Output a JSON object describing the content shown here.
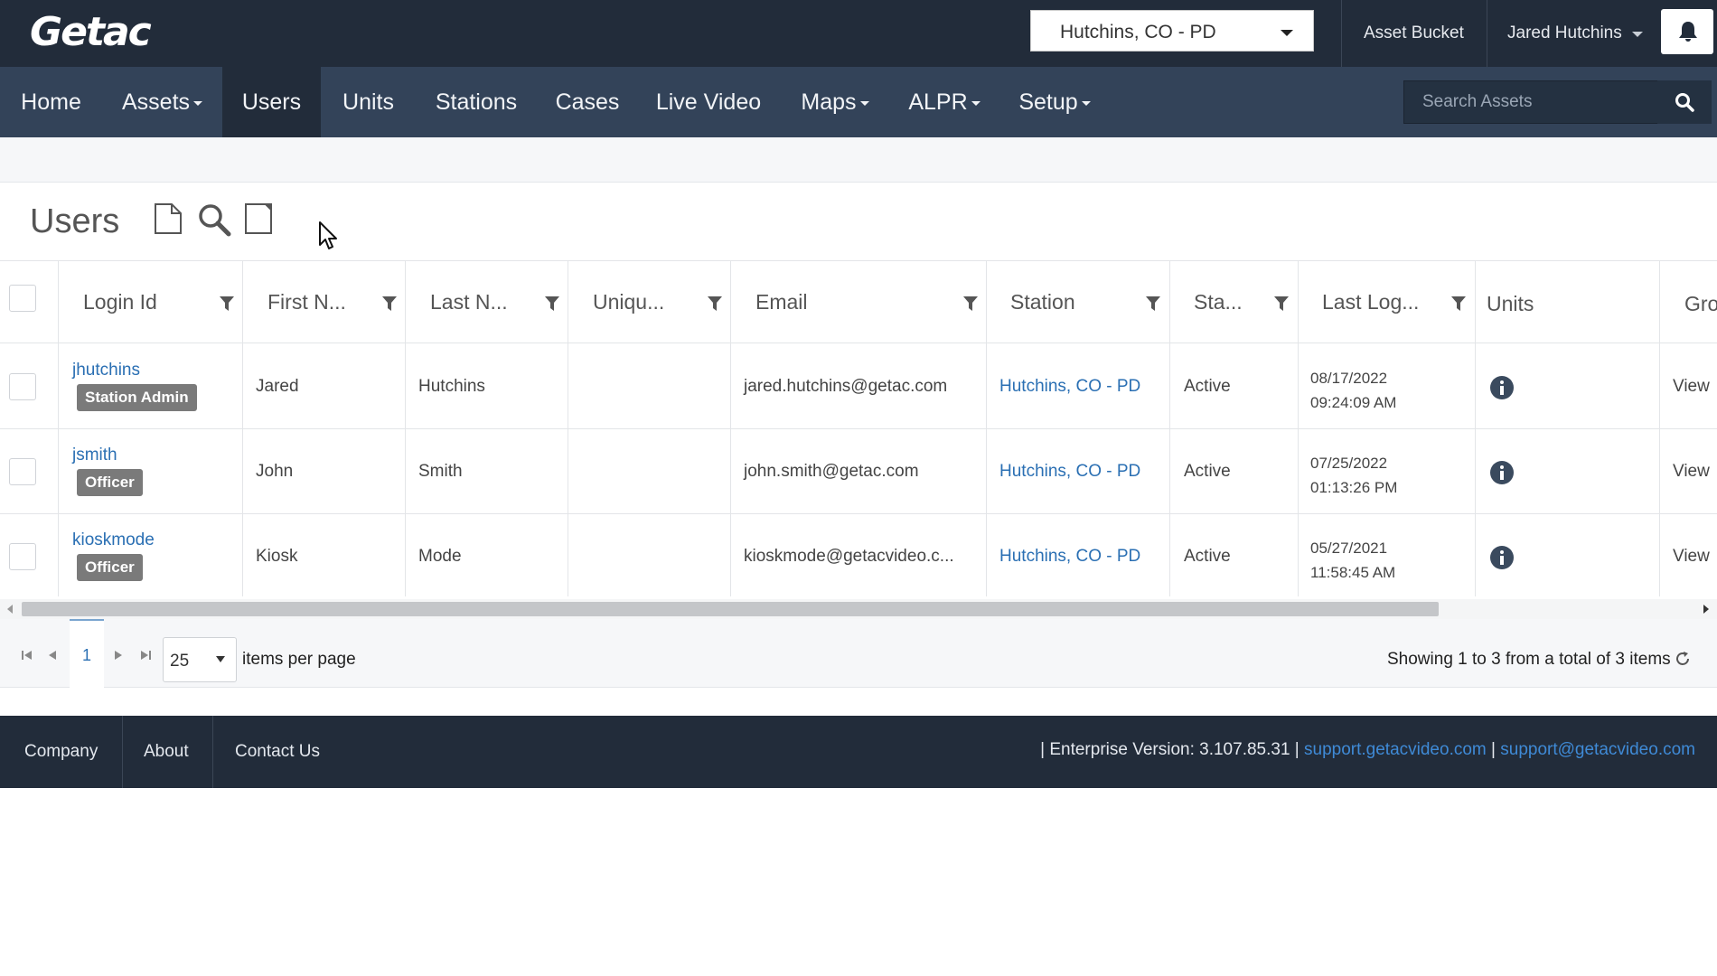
{
  "header": {
    "logo": "Getac",
    "agency_select": "Hutchins, CO - PD",
    "asset_bucket": "Asset Bucket",
    "user_name": "Jared Hutchins"
  },
  "nav": {
    "items": [
      {
        "label": "Home"
      },
      {
        "label": "Assets"
      },
      {
        "label": "Users"
      },
      {
        "label": "Units"
      },
      {
        "label": "Stations"
      },
      {
        "label": "Cases"
      },
      {
        "label": "Live Video"
      },
      {
        "label": "Maps"
      },
      {
        "label": "ALPR"
      },
      {
        "label": "Setup"
      }
    ],
    "active": "Users",
    "search_placeholder": "Search Assets"
  },
  "page": {
    "title": "Users"
  },
  "table": {
    "columns": [
      "Login Id",
      "First N...",
      "Last N...",
      "Uniqu...",
      "Email",
      "Station",
      "Sta...",
      "Last Log...",
      "Units",
      "Gro"
    ],
    "rows": [
      {
        "login": "jhutchins",
        "role": "Station Admin",
        "first": "Jared",
        "last": "Hutchins",
        "unique": "",
        "email": "jared.hutchins@getac.com",
        "station": "Hutchins, CO - PD",
        "status": "Active",
        "last_login_date": "08/17/2022",
        "last_login_time": "09:24:09 AM",
        "group": "View"
      },
      {
        "login": "jsmith",
        "role": "Officer",
        "first": "John",
        "last": "Smith",
        "unique": "",
        "email": "john.smith@getac.com",
        "station": "Hutchins, CO - PD",
        "status": "Active",
        "last_login_date": "07/25/2022",
        "last_login_time": "01:13:26 PM",
        "group": "View"
      },
      {
        "login": "kioskmode",
        "role": "Officer",
        "first": "Kiosk",
        "last": "Mode",
        "unique": "",
        "email": "kioskmode@getacvideo.c...",
        "station": "Hutchins, CO - PD",
        "status": "Active",
        "last_login_date": "05/27/2021",
        "last_login_time": "11:58:45 AM",
        "group": "View"
      }
    ]
  },
  "pager": {
    "current_page": "1",
    "per_page": "25",
    "per_page_label": "items per page",
    "showing": "Showing 1 to 3 from a total of 3 items"
  },
  "footer": {
    "company": "Company",
    "about": "About",
    "contact": "Contact Us",
    "version_prefix": "| Enterprise Version: 3.107.85.31 |",
    "support_site": "support.getacvideo.com",
    "sep": "|",
    "support_email": "support@getacvideo.com"
  },
  "colors": {
    "topbar": "#222c3a",
    "navbar": "#334359",
    "link": "#2a6fb3",
    "badge": "#7a7a7a"
  }
}
